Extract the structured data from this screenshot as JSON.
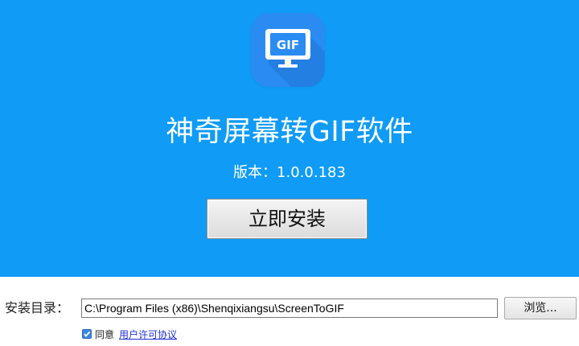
{
  "app": {
    "title": "神奇屏幕转GIF软件",
    "version_text": "版本：1.0.0.183",
    "icon": "gif-monitor-icon",
    "icon_text": "GIF"
  },
  "install": {
    "button_label": "立即安装"
  },
  "directory": {
    "label": "安装目录：",
    "path": "C:\\Program Files (x86)\\Shenqixiangsu\\ScreenToGIF",
    "browse_label": "浏览..."
  },
  "agreement": {
    "checked": true,
    "agree_label": "同意",
    "license_link": "用户许可协议"
  },
  "colors": {
    "hero_background": "#0f9bf6",
    "icon_background": "#2a8cf2",
    "link": "#1f2fd0"
  }
}
